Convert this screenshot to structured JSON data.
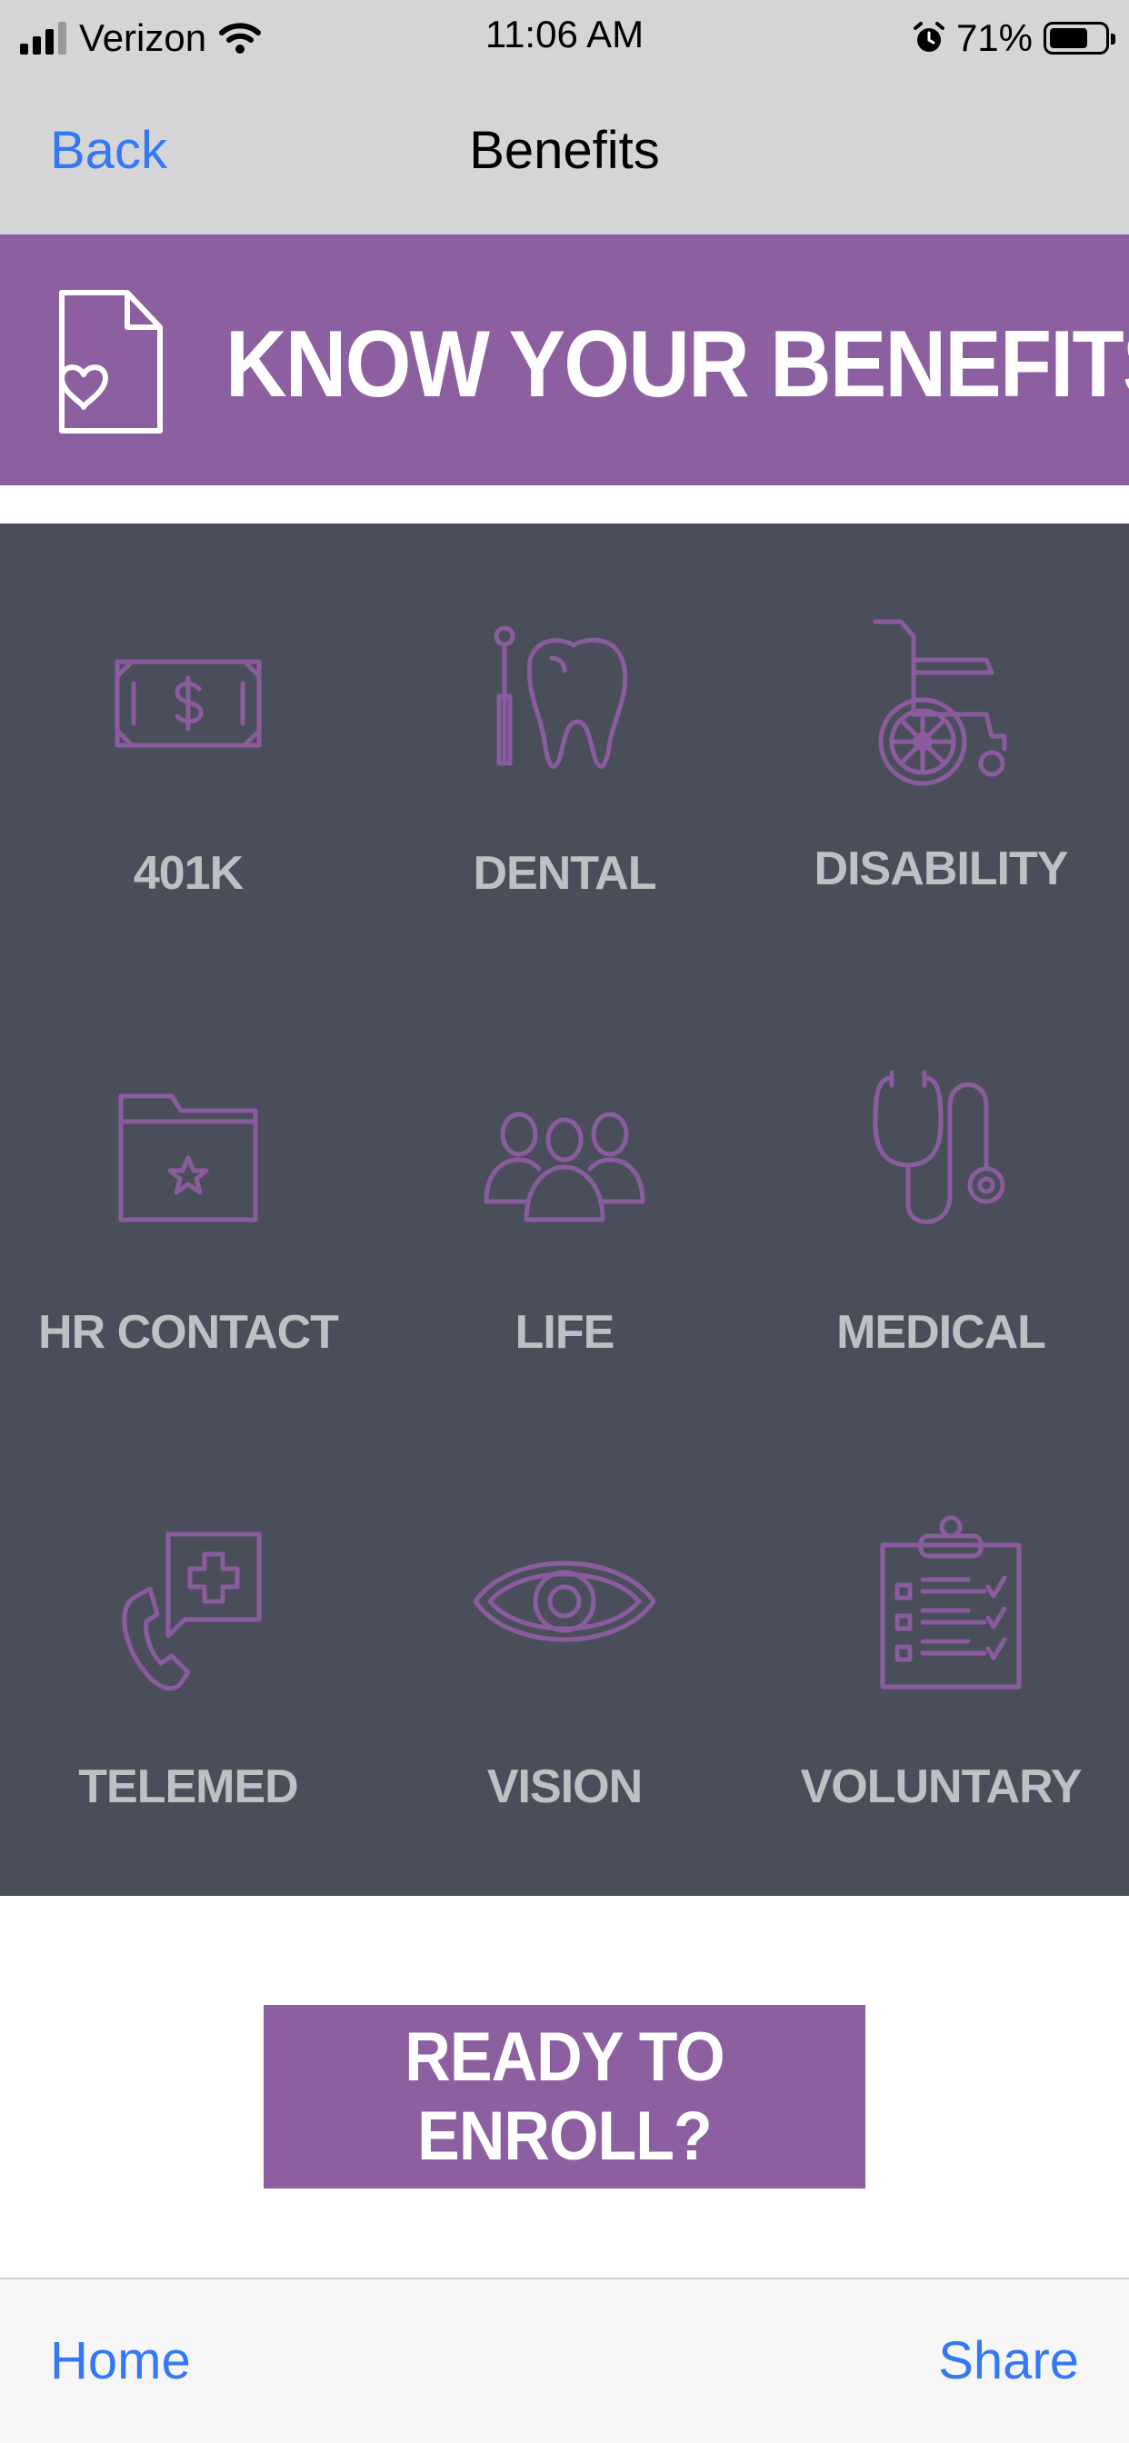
{
  "status_bar": {
    "carrier": "Verizon",
    "time": "11:06 AM",
    "battery": "71%",
    "battery_level": 0.71
  },
  "nav": {
    "back_label": "Back",
    "title": "Benefits"
  },
  "banner": {
    "headline": "KNOW YOUR BENEFITS",
    "icon": "document-heart-icon"
  },
  "benefits": [
    {
      "label": "401K",
      "icon": "money-bill-icon"
    },
    {
      "label": "DENTAL",
      "icon": "tooth-icon"
    },
    {
      "label": "DISABILITY",
      "icon": "wheelchair-icon"
    },
    {
      "label": "HR CONTACT",
      "icon": "folder-star-icon"
    },
    {
      "label": "LIFE",
      "icon": "people-group-icon"
    },
    {
      "label": "MEDICAL",
      "icon": "stethoscope-icon"
    },
    {
      "label": "TELEMED",
      "icon": "phone-cross-icon"
    },
    {
      "label": "VISION",
      "icon": "eye-icon"
    },
    {
      "label": "VOLUNTARY",
      "icon": "clipboard-checklist-icon"
    }
  ],
  "enroll": {
    "label": "READY TO ENROLL?"
  },
  "toolbar": {
    "home_label": "Home",
    "share_label": "Share"
  },
  "colors": {
    "accent": "#8c5fa0",
    "panel": "#4a4e5a",
    "link": "#3478f6",
    "icon_stroke": "#8a5c9e"
  }
}
